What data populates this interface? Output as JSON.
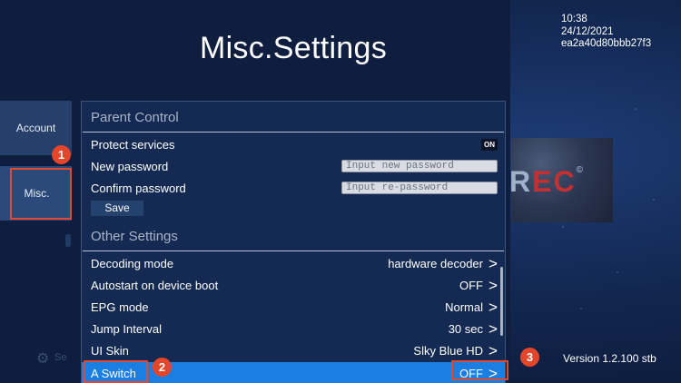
{
  "page": {
    "title": "Misc.Settings"
  },
  "sidebar": {
    "items": [
      {
        "label": "Account"
      },
      {
        "label": "Misc."
      }
    ]
  },
  "parent_control": {
    "header": "Parent Control",
    "protect_services": {
      "label": "Protect services",
      "value": "ON"
    },
    "new_password": {
      "label": "New password",
      "placeholder": "Input new password"
    },
    "confirm_password": {
      "label": "Confirm password",
      "placeholder": "Input re-password"
    },
    "save_label": "Save"
  },
  "other_settings": {
    "header": "Other Settings",
    "rows": [
      {
        "label": "Decoding mode",
        "value": "hardware decoder"
      },
      {
        "label": "Autostart on device boot",
        "value": "OFF"
      },
      {
        "label": "EPG mode",
        "value": "Normal"
      },
      {
        "label": "Jump Interval",
        "value": "30 sec"
      },
      {
        "label": "UI Skin",
        "value": "Slky Blue HD"
      },
      {
        "label": "A Switch",
        "value": "OFF",
        "selected": true
      }
    ],
    "arrow_glyph": ">"
  },
  "info": {
    "time": "10:38",
    "date": "24/12/2021",
    "device_id": "ea2a40d80bbb27f3"
  },
  "logo": {
    "text_plain": "R",
    "text_accent": "EC",
    "mark": "©"
  },
  "version": "Version 1.2.100 stb",
  "background_fragment": "Se",
  "markers": [
    "1",
    "2",
    "3"
  ],
  "colors": {
    "accent_blue": "#1a7ee2",
    "callout_red": "#e04a33",
    "panel_bg": "#0f1e3f"
  },
  "icons": {
    "settings": "gear-icon",
    "row_arrow": "chevron-right-icon"
  }
}
